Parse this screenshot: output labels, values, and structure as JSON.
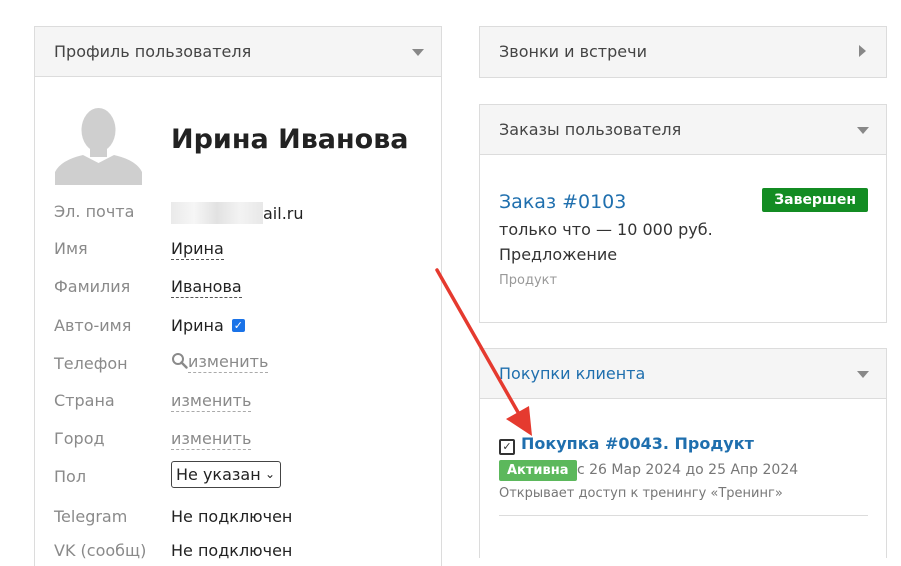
{
  "profile": {
    "header": "Профиль пользователя",
    "name": "Ирина Иванова",
    "email_label": "Эл. почта",
    "email_visible": "ail.ru",
    "first_name_label": "Имя",
    "first_name": "Ирина",
    "last_name_label": "Фамилия",
    "last_name": "Иванова",
    "auto_name_label": "Авто-имя",
    "auto_name": "Ирина",
    "auto_name_checked": true,
    "phone_label": "Телефон",
    "phone_action": "изменить",
    "country_label": "Страна",
    "country_action": "изменить",
    "city_label": "Город",
    "city_action": "изменить",
    "gender_label": "Пол",
    "gender_value": "Не указан",
    "telegram_label": "Telegram",
    "telegram_value": "Не подключен",
    "vk_label": "VK (сообщ)",
    "vk_value": "Не подключен"
  },
  "calls": {
    "header": "Звонки и встречи"
  },
  "orders": {
    "header": "Заказы пользователя",
    "order_link": "Заказ #0103",
    "status": "Завершен",
    "status_color": "#138c23",
    "time_and_sum": "только что — 10 000 руб.",
    "stage": "Предложение",
    "product_type": "Продукт"
  },
  "purchases": {
    "header": "Покупки клиента",
    "title": "Покупка #0043. Продукт",
    "status": "Активна",
    "status_color": "#5cb85c",
    "dates": "с 26 Мар 2024 до 25 Апр 2024",
    "description": "Открывает доступ к тренингу «Тренинг»"
  },
  "annotation": {
    "arrow_color": "#e53a2f"
  }
}
